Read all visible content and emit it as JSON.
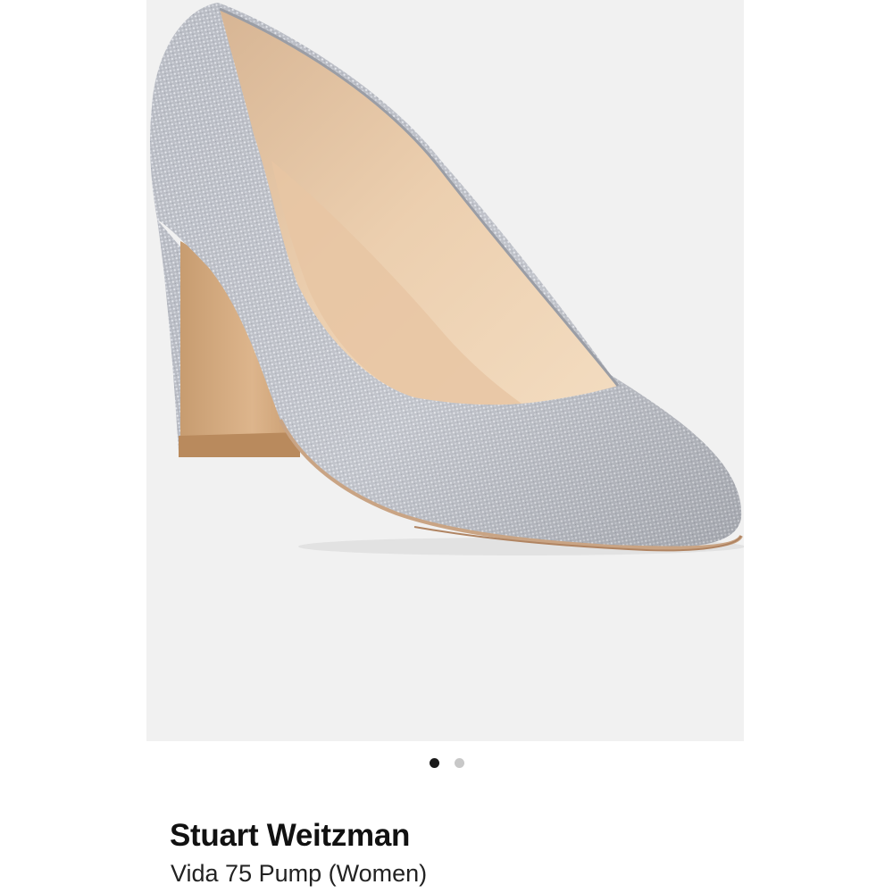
{
  "product": {
    "brand": "Stuart Weitzman",
    "name": "Vida 75 Pump (Women)"
  },
  "gallery": {
    "image_count": 2,
    "active_index": 0
  },
  "colors": {
    "image_background": "#f1f1f1",
    "dot_active": "#1a1a1a",
    "dot_inactive": "#c8c8c8"
  }
}
